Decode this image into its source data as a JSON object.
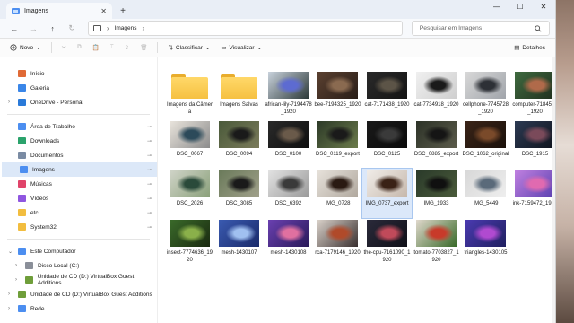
{
  "window": {
    "tab_title": "Imagens",
    "new_tab": "+",
    "tab_close": "✕",
    "minimize": "—",
    "maximize": "☐",
    "close": "✕"
  },
  "address": {
    "location": "Imagens",
    "separator": "›",
    "search_placeholder": "Pesquisar em Imagens"
  },
  "nav": {
    "back": "←",
    "forward": "→",
    "up": "↑",
    "refresh": "↻"
  },
  "toolbar": {
    "new_label": "Novo",
    "sort_label": "Classificar",
    "view_label": "Visualizar",
    "more": "···",
    "details_label": "Detalhes"
  },
  "sidebar": {
    "items": [
      {
        "label": "Início",
        "icon": "home-icon",
        "color": "#e06a36"
      },
      {
        "label": "Galeria",
        "icon": "gallery-icon",
        "color": "#3a86e8"
      },
      {
        "label": "OneDrive - Personal",
        "icon": "cloud-icon",
        "color": "#2a7ad9",
        "chev": "›"
      }
    ],
    "pinned": [
      {
        "label": "Área de Trabalho",
        "icon": "desktop-icon",
        "color": "#4c8ef0"
      },
      {
        "label": "Downloads",
        "icon": "download-icon",
        "color": "#2ba36c"
      },
      {
        "label": "Documentos",
        "icon": "documents-icon",
        "color": "#7a8ba3"
      },
      {
        "label": "Imagens",
        "icon": "pictures-icon",
        "color": "#4c8ef0",
        "selected": true
      },
      {
        "label": "Músicas",
        "icon": "music-icon",
        "color": "#e0446a"
      },
      {
        "label": "Vídeos",
        "icon": "videos-icon",
        "color": "#8f56e0"
      },
      {
        "label": "etc",
        "icon": "folder-icon",
        "color": "#f2bd3f"
      },
      {
        "label": "System32",
        "icon": "folder-icon",
        "color": "#f2bd3f"
      }
    ],
    "drives": [
      {
        "label": "Este Computador",
        "icon": "computer-icon",
        "color": "#4c8ef0",
        "chev": "⌄"
      },
      {
        "label": "Disco Local (C:)",
        "icon": "drive-icon",
        "color": "#8a8f99",
        "chev": "›",
        "indent": true
      },
      {
        "label": "Unidade de CD (D:) VirtualBox Guest Additions",
        "icon": "cd-icon",
        "color": "#6f9e3a",
        "chev": "›",
        "indent": true
      },
      {
        "label": "Unidade de CD (D:) VirtualBox Guest Additions",
        "icon": "cd-icon",
        "color": "#6f9e3a",
        "chev": "›"
      },
      {
        "label": "Rede",
        "icon": "network-icon",
        "color": "#4c8ef0",
        "chev": "›"
      }
    ],
    "pin_glyph": "📌"
  },
  "files": [
    {
      "name": "Imagens da Câmera",
      "type": "folder"
    },
    {
      "name": "Imagens Salvas",
      "type": "folder"
    },
    {
      "name": "african-lily-7194478_1920",
      "colors": [
        "#c9d2dc",
        "#5d6bd1",
        "#2d3a3a"
      ]
    },
    {
      "name": "bee-7194325_1920",
      "colors": [
        "#5a4030",
        "#8a6a50",
        "#2a1e18"
      ]
    },
    {
      "name": "cat-7171438_1920",
      "colors": [
        "#2a2a2a",
        "#5c5447",
        "#141414"
      ]
    },
    {
      "name": "cat-7734918_1920",
      "colors": [
        "#f0f0f0",
        "#1a1a1a",
        "#cfcfcf"
      ]
    },
    {
      "name": "cellphone-7745728_1920",
      "colors": [
        "#d8d8d8",
        "#2d3036",
        "#a0a4aa"
      ]
    },
    {
      "name": "computer-7184522_1920",
      "colors": [
        "#3f6a3f",
        "#b06a4a",
        "#20301f"
      ]
    },
    {
      "name": "DSC_0067",
      "colors": [
        "#e9e4dc",
        "#2c4a5a",
        "#8c8c8c"
      ]
    },
    {
      "name": "DSC_0094",
      "colors": [
        "#4a5a3a",
        "#1a1a1a",
        "#7a7a5a"
      ]
    },
    {
      "name": "DSC_0100",
      "colors": [
        "#2a2a2a",
        "#6a5a4a",
        "#0f0f0f"
      ]
    },
    {
      "name": "DSC_0119_export",
      "colors": [
        "#2d3a28",
        "#1a1a1a",
        "#6a7a4a"
      ]
    },
    {
      "name": "DSC_0125",
      "colors": [
        "#1a1a1a",
        "#3a3a3a",
        "#0a0a0a"
      ]
    },
    {
      "name": "DSC_0885_export",
      "colors": [
        "#2d3328",
        "#151515",
        "#5a5a4a"
      ]
    },
    {
      "name": "DSC_1062_original",
      "colors": [
        "#3a2418",
        "#7a4a2a",
        "#1a100a"
      ]
    },
    {
      "name": "DSC_1915",
      "colors": [
        "#2c3a52",
        "#7a4a5a",
        "#10141e"
      ]
    },
    {
      "name": "DSC_2026",
      "colors": [
        "#d0d4c8",
        "#2a4a3a",
        "#8aa07a"
      ]
    },
    {
      "name": "DSC_3085",
      "colors": [
        "#6a7a5a",
        "#1a1a1a",
        "#a0a08a"
      ]
    },
    {
      "name": "DSC_6392",
      "colors": [
        "#e2e2e2",
        "#3a3a3a",
        "#9a9a9a"
      ]
    },
    {
      "name": "IMG_0728",
      "colors": [
        "#e6e1da",
        "#2a1a12",
        "#b0a89e"
      ]
    },
    {
      "name": "IMG_0737_export",
      "colors": [
        "#f0ece8",
        "#3a2216",
        "#c6b8ac"
      ],
      "selected": true
    },
    {
      "name": "IMG_1933",
      "colors": [
        "#2a3a2a",
        "#101010",
        "#4a5a3a"
      ]
    },
    {
      "name": "IMG_5449",
      "colors": [
        "#d8d8d8",
        "#5a6a7a",
        "#eeeeee"
      ]
    },
    {
      "name": "ink-7159472_1920",
      "colors": [
        "#c080e0",
        "#e06ab0",
        "#5a40b0"
      ]
    },
    {
      "name": "insect-7774636_1920",
      "colors": [
        "#3a6a2a",
        "#8ab04a",
        "#1a2a10"
      ]
    },
    {
      "name": "mesh-1430107",
      "colors": [
        "#3a5ab0",
        "#a0c0f0",
        "#1a2a6a"
      ]
    },
    {
      "name": "mesh-1430108",
      "colors": [
        "#6a40b0",
        "#e070a0",
        "#2a1a5a"
      ]
    },
    {
      "name": "rca-7179146_1920",
      "colors": [
        "#d8d0c8",
        "#b04a2a",
        "#3a3030"
      ]
    },
    {
      "name": "the-cpu-7161090_1920",
      "colors": [
        "#2a2a3a",
        "#c04a5a",
        "#101018"
      ]
    },
    {
      "name": "tomato-7703827_1920",
      "colors": [
        "#e0d8cc",
        "#c83a2a",
        "#3a6a2a"
      ]
    },
    {
      "name": "triangles-1430105",
      "colors": [
        "#4a3ab0",
        "#b04ad0",
        "#202060"
      ]
    }
  ]
}
